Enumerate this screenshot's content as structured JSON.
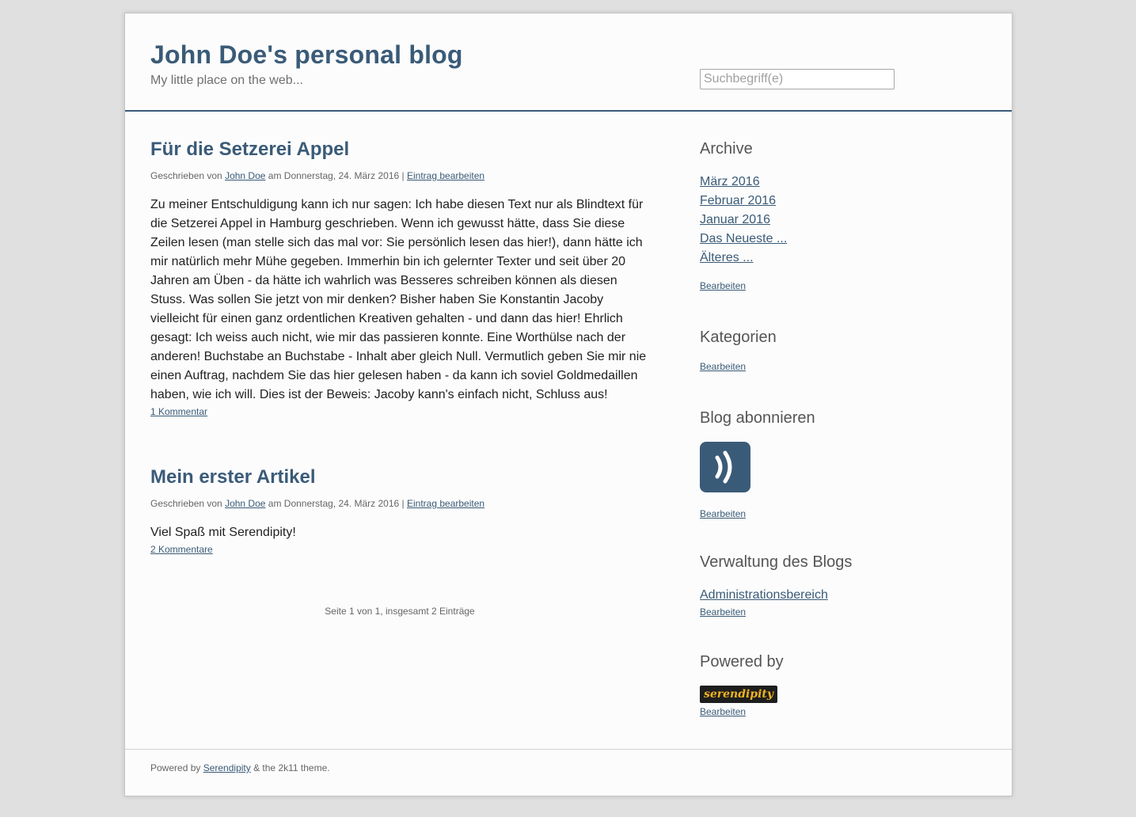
{
  "header": {
    "title": "John Doe's personal blog",
    "description": "My little place on the web...",
    "search_placeholder": "Suchbegriff(e)"
  },
  "entries": [
    {
      "title": "Für die Setzerei Appel",
      "meta_prefix": "Geschrieben von ",
      "author": "John Doe",
      "meta_date": " am Donnerstag, 24. März 2016 | ",
      "edit_link": "Eintrag bearbeiten",
      "body": "Zu meiner Entschuldigung kann ich nur sagen: Ich habe diesen Text nur als Blindtext für die Setzerei Appel in Hamburg geschrieben. Wenn ich gewusst hätte, dass Sie diese Zeilen lesen (man stelle sich das mal vor: Sie persönlich lesen das hier!), dann hätte ich mir natürlich mehr Mühe gegeben. Immerhin bin ich gelernter Texter und seit über 20 Jahren am Üben - da hätte ich wahrlich was Besseres schreiben können als diesen Stuss. Was sollen Sie jetzt von mir denken? Bisher haben Sie Konstantin Jacoby vielleicht für einen ganz ordentlichen Kreativen gehalten - und dann das hier! Ehrlich gesagt: Ich weiss auch nicht, wie mir das passieren konnte. Eine Worthülse nach der anderen! Buchstabe an Buchstabe - Inhalt aber gleich Null. Vermutlich geben Sie mir nie einen Auftrag, nachdem Sie das hier gelesen haben - da kann ich soviel Goldmedaillen haben, wie ich will. Dies ist der Beweis: Jacoby kann's einfach nicht, Schluss aus!",
      "comments": "1 Kommentar"
    },
    {
      "title": "Mein erster Artikel",
      "meta_prefix": "Geschrieben von ",
      "author": "John Doe",
      "meta_date": " am Donnerstag, 24. März 2016 | ",
      "edit_link": "Eintrag bearbeiten",
      "body": "Viel Spaß mit Serendipity!",
      "comments": "2 Kommentare"
    }
  ],
  "pager": "Seite 1 von 1, insgesamt 2 Einträge",
  "sidebar": {
    "archive": {
      "title": "Archive",
      "links": [
        "März 2016",
        "Februar 2016",
        "Januar 2016",
        "Das Neueste ...",
        "Älteres ..."
      ],
      "edit": "Bearbeiten"
    },
    "categories": {
      "title": "Kategorien",
      "edit": "Bearbeiten"
    },
    "subscribe": {
      "title": "Blog abonnieren",
      "icon": "rss-feed-icon",
      "edit": "Bearbeiten"
    },
    "admin": {
      "title": "Verwaltung des Blogs",
      "link": "Administrationsbereich",
      "edit": "Bearbeiten"
    },
    "powered": {
      "title": "Powered by",
      "logo_text": "serendipity",
      "edit": "Bearbeiten"
    }
  },
  "footer": {
    "prefix": "Powered by ",
    "link": "Serendipity",
    "suffix": " & the 2k11 theme."
  },
  "colors": {
    "accent": "#3a5b78",
    "background": "#e0e0e0",
    "page": "#fcfcfc"
  }
}
